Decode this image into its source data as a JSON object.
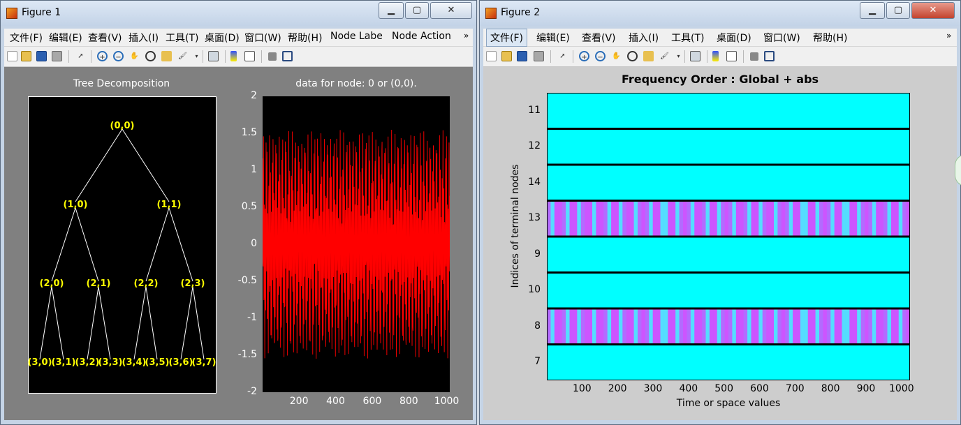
{
  "figure1": {
    "title": "Figure 1",
    "menu": [
      "文件(F)",
      "编辑(E)",
      "查看(V)",
      "插入(I)",
      "工具(T)",
      "桌面(D)",
      "窗口(W)",
      "帮助(H)",
      "Node Labe",
      "Node Action"
    ],
    "overflow": "»",
    "tree_title": "Tree Decomposition",
    "nodes": [
      "(0,0)",
      "(1,0)",
      "(1,1)",
      "(2,0)",
      "(2,1)",
      "(2,2)",
      "(2,3)",
      "(3,0)",
      "(3,1)",
      "(3,2)",
      "(3,3)",
      "(3,4)",
      "(3,5)",
      "(3,6)",
      "(3,7)"
    ],
    "signal_title": "data for node: 0 or (0,0).",
    "signal_yticks": [
      "2",
      "1.5",
      "1",
      "0.5",
      "0",
      "-0.5",
      "-1",
      "-1.5",
      "-2"
    ],
    "signal_xticks": [
      "200",
      "400",
      "600",
      "800",
      "1000"
    ]
  },
  "figure2": {
    "title": "Figure 2",
    "menu": [
      "文件(F)",
      "编辑(E)",
      "查看(V)",
      "插入(I)",
      "工具(T)",
      "桌面(D)",
      "窗口(W)",
      "帮助(H)"
    ],
    "overflow": "»",
    "chart_title": "Frequency Order : Global + abs",
    "ylabel": "Indices of terminal nodes",
    "xlabel": "Time or space values",
    "yticks": [
      "11",
      "12",
      "14",
      "13",
      "9",
      "10",
      "8",
      "7"
    ],
    "xticks": [
      "100",
      "200",
      "300",
      "400",
      "500",
      "600",
      "700",
      "800",
      "900",
      "1000"
    ]
  },
  "chart_data": [
    {
      "type": "line",
      "title": "data for node: 0 or (0,0).",
      "xlabel": "",
      "ylabel": "",
      "xlim": [
        1,
        1024
      ],
      "ylim": [
        -2,
        2
      ],
      "series": [
        {
          "color": "#ff0000",
          "amplitude_envelope": [
            -1.55,
            1.55
          ],
          "samples": 1024
        }
      ]
    },
    {
      "type": "heatmap",
      "title": "Frequency Order : Global + abs",
      "xlabel": "Time or space values",
      "ylabel": "Indices of terminal nodes",
      "xlim": [
        1,
        1024
      ],
      "rows": [
        "11",
        "12",
        "14",
        "13",
        "9",
        "10",
        "8",
        "7"
      ],
      "row_energy": [
        "low",
        "low",
        "low",
        "high",
        "low",
        "low",
        "high",
        "low"
      ]
    }
  ],
  "colors": {
    "accent_red": "#ff0000",
    "node_yellow": "#ffff00",
    "cyan": "#00ffff",
    "magenta": "#cc55ff"
  }
}
